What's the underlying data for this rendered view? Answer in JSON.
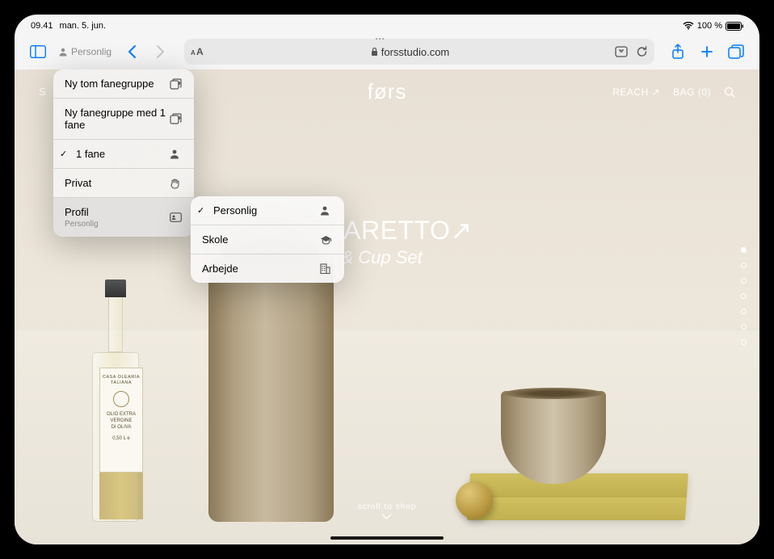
{
  "status": {
    "time": "09.41",
    "date": "man. 5. jun.",
    "battery": "100 %"
  },
  "toolbar": {
    "profile_label": "Personlig",
    "url": "forsstudio.com"
  },
  "site": {
    "menu_shop": "S",
    "logo": "førs",
    "reach_label": "REACH",
    "bag_label": "BAG (0)",
    "hero_title": "MARETTO",
    "hero_sub": "fe & Cup Set",
    "scroll_hint": "scroll to shop"
  },
  "bottle_label": {
    "brand": "CASA OLEARIA TALIANA",
    "line1": "OLIO EXTRA",
    "line2": "VERGINE",
    "line3": "DI OLIVA",
    "vol": "0,50 L e"
  },
  "menu": {
    "items": [
      {
        "label": "Ny tom fanegruppe",
        "icon": "tabgroup-add-icon"
      },
      {
        "label": "Ny fanegruppe med 1 fane",
        "icon": "tabgroup-add-icon"
      },
      {
        "label": "1 fane",
        "icon": "person-icon",
        "checked": true
      },
      {
        "label": "Privat",
        "icon": "hand-icon"
      },
      {
        "label": "Profil",
        "sub": "Personlig",
        "icon": "profile-card-icon",
        "selected": true
      }
    ]
  },
  "submenu": {
    "items": [
      {
        "label": "Personlig",
        "icon": "person-icon",
        "checked": true
      },
      {
        "label": "Skole",
        "icon": "graduation-icon"
      },
      {
        "label": "Arbejde",
        "icon": "building-icon"
      }
    ]
  }
}
